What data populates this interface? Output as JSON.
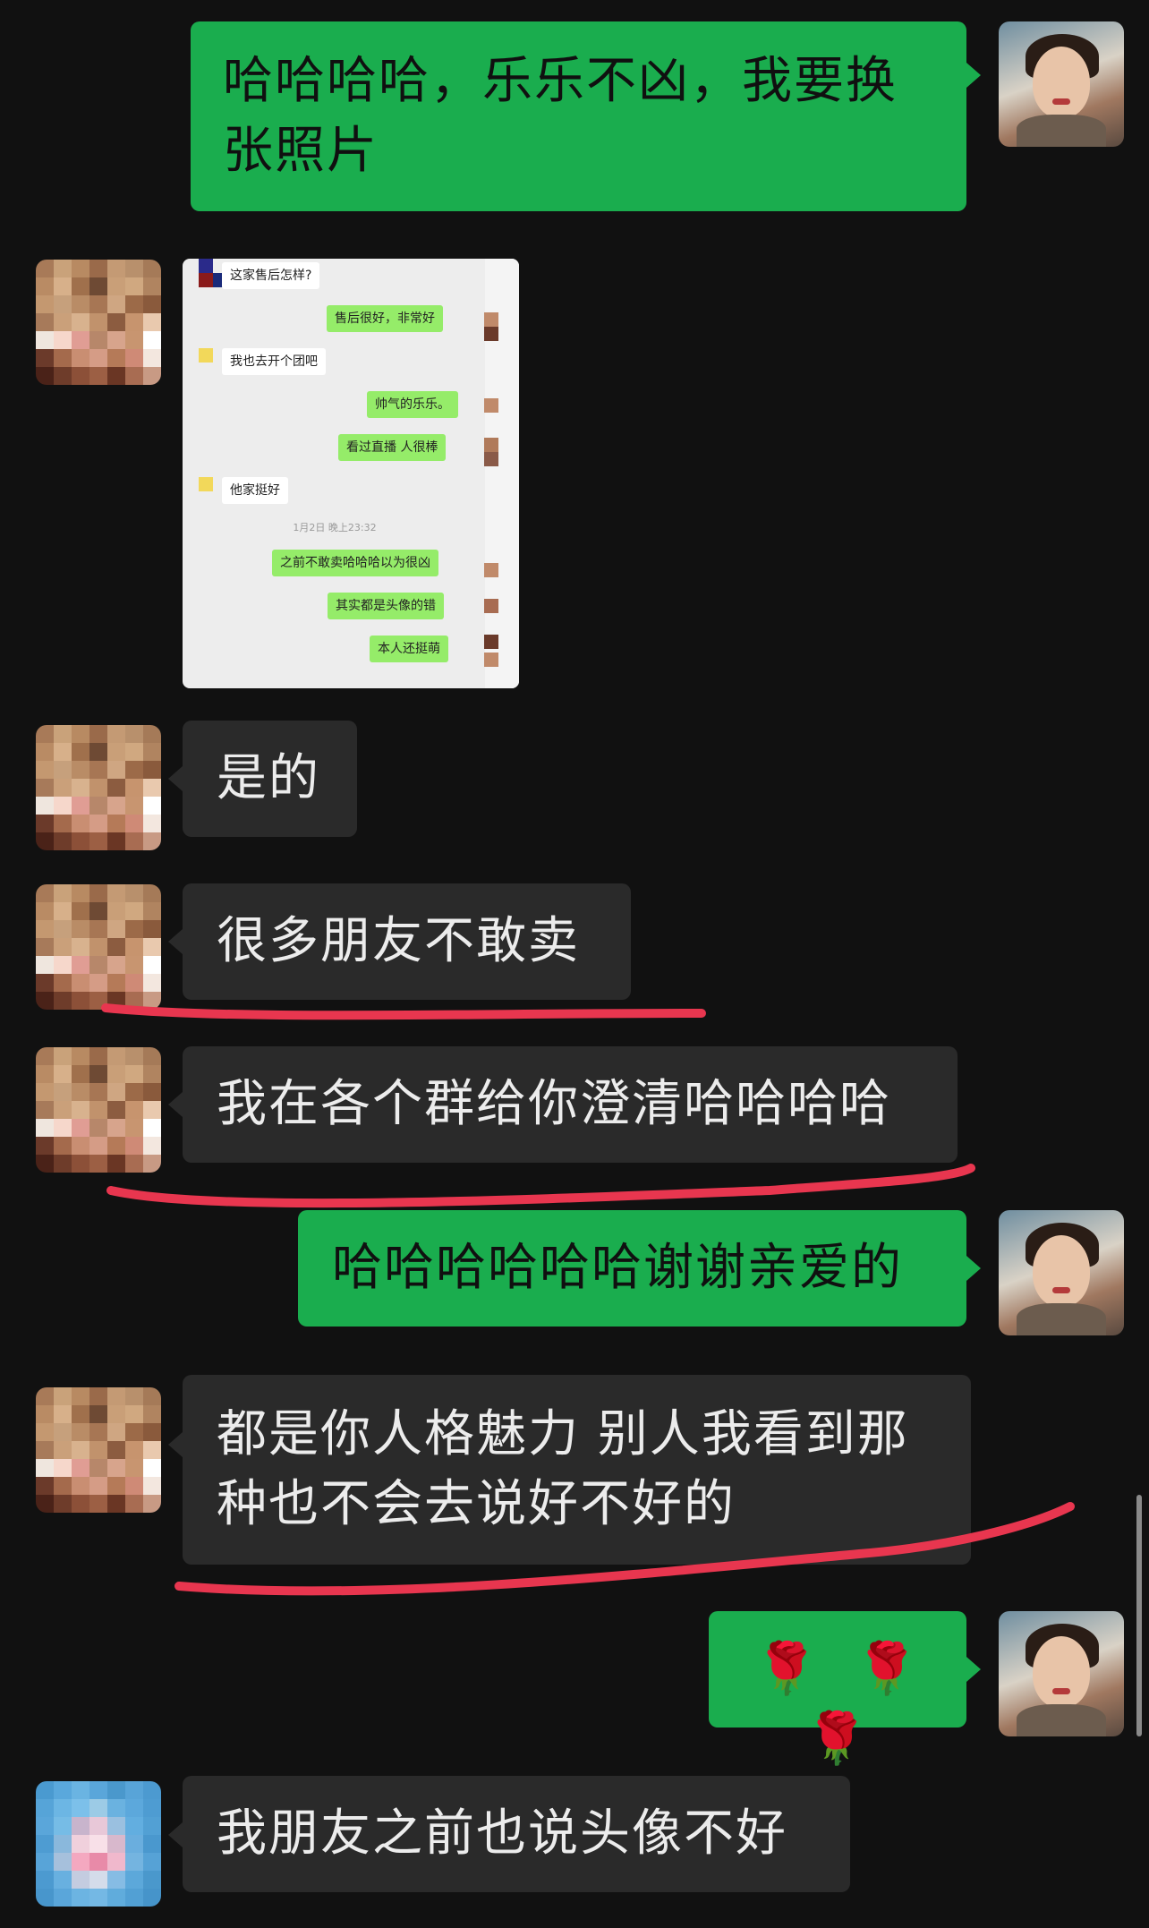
{
  "messages": {
    "m1": "哈哈哈哈，乐乐不凶，我要换张照片",
    "m1_line1": "哈哈哈哈，乐乐不凶，我要换",
    "m1_line2": "张照片",
    "m3": "是的",
    "m4": "很多朋友不敢卖",
    "m5": "我在各个群给你澄清哈哈哈哈",
    "m6": "哈哈哈哈哈哈谢谢亲爱的",
    "m7_line1": "都是你人格魅力 别人我看到那",
    "m7_line2": "种也不会去说好不好的",
    "m8_icons": [
      "rose-icon",
      "rose-icon",
      "rose-icon"
    ],
    "m8_glyph": "🌹",
    "m9": "我朋友之前也说头像不好"
  },
  "screenshot": {
    "q1": "这家售后怎样?",
    "a1": "售后很好，非常好",
    "q2": "我也去开个团吧",
    "a2": "帅气的乐乐。",
    "a3": "看过直播 人很棒",
    "q3": "他家挺好",
    "timestamp": "1月2日 晚上23:32",
    "a4": "之前不敢卖哈哈哈以为很凶",
    "a5": "其实都是头像的错",
    "a6": "本人还挺萌"
  },
  "colors": {
    "background": "#111111",
    "my_bubble": "#1aad4e",
    "their_bubble": "#2a2a2a",
    "underline": "#e8364f"
  }
}
